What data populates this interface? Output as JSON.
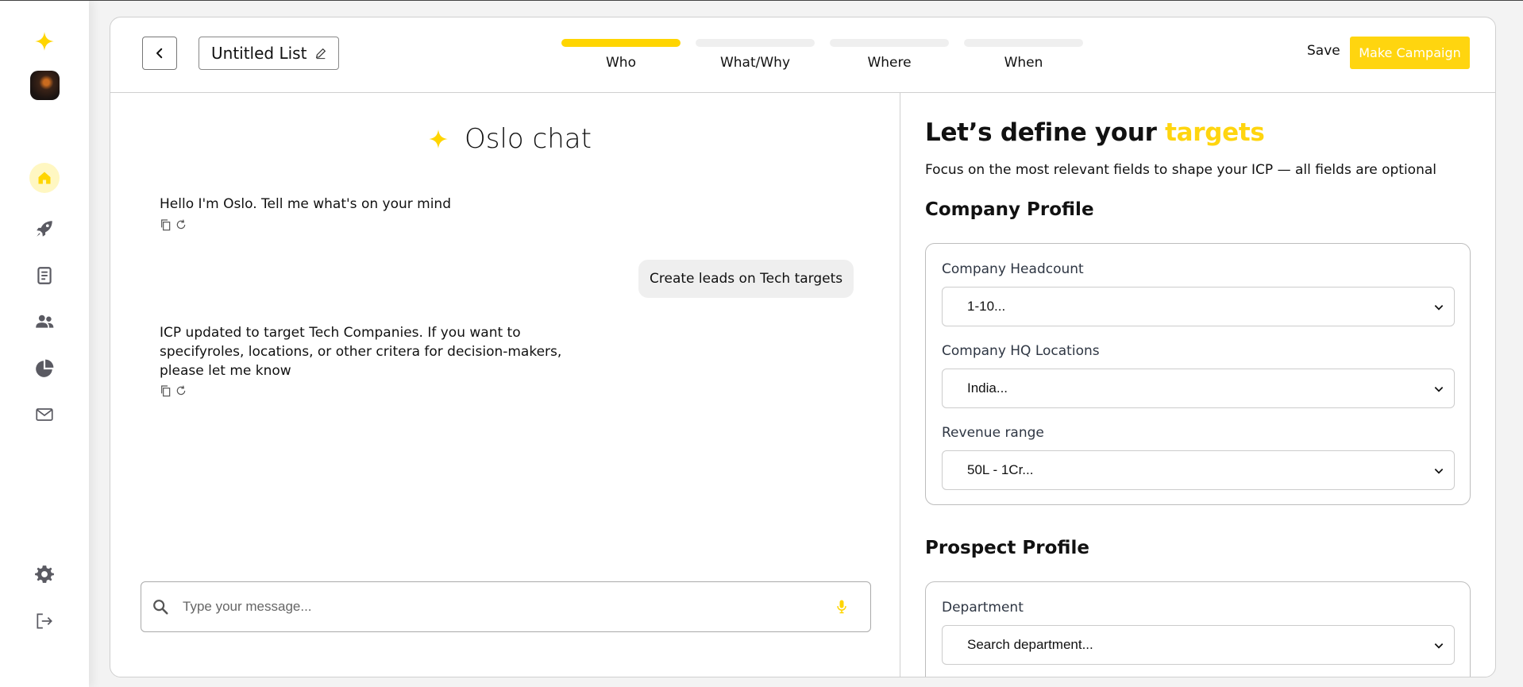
{
  "sidebar": {
    "items": [
      {
        "name": "logo-sparkle-icon"
      },
      {
        "name": "avatar"
      },
      {
        "name": "home-icon"
      },
      {
        "name": "rocket-icon"
      },
      {
        "name": "document-icon"
      },
      {
        "name": "users-icon"
      },
      {
        "name": "pie-chart-icon"
      },
      {
        "name": "mail-icon"
      },
      {
        "name": "settings-icon"
      },
      {
        "name": "logout-icon"
      }
    ],
    "accent": "#ffd500"
  },
  "header": {
    "list_title": "Untitled List",
    "steps": [
      {
        "label": "Who",
        "active": true
      },
      {
        "label": "What/Why",
        "active": false
      },
      {
        "label": "Where",
        "active": false
      },
      {
        "label": "When",
        "active": false
      }
    ],
    "save_label": "Save",
    "campaign_label": "Make Campaign"
  },
  "chat": {
    "title": "Oslo chat",
    "messages": [
      {
        "role": "bot",
        "text": "Hello I'm Oslo. Tell me what's on your mind"
      },
      {
        "role": "user",
        "text": "Create leads on Tech targets"
      },
      {
        "role": "bot",
        "text": "ICP updated to target Tech Companies. If you want to specifyroles, locations, or other critera for decision-makers, please let me know"
      }
    ],
    "input_placeholder": "Type your message..."
  },
  "panel": {
    "heading_prefix": "Let’s define your ",
    "heading_highlight": "targets",
    "subtitle": "Focus on the most relevant fields to shape your ICP — all fields are optional",
    "company_section": "Company Profile",
    "company_fields": [
      {
        "label": "Company Headcount",
        "value": "1-10..."
      },
      {
        "label": "Company HQ Locations",
        "value": "India..."
      },
      {
        "label": "Revenue range",
        "value": "50L - 1Cr..."
      }
    ],
    "prospect_section": "Prospect Profile",
    "prospect_fields": [
      {
        "label": "Department",
        "value": "Search department..."
      }
    ]
  }
}
